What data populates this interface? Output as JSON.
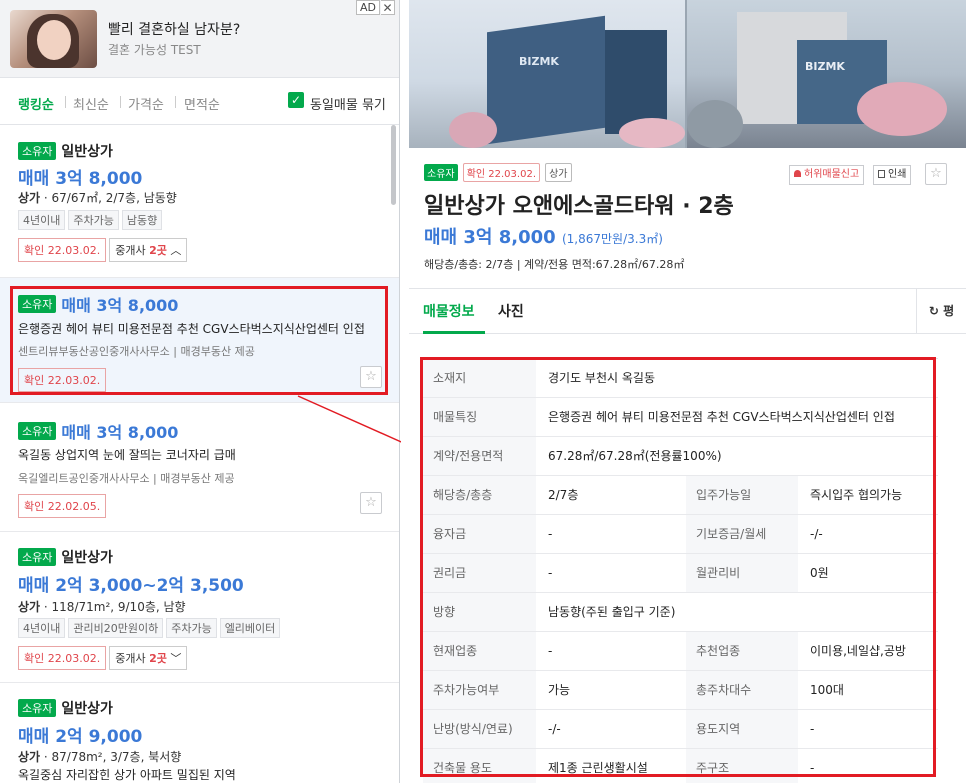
{
  "ad": {
    "title": "빨리 결혼하실 남자분?",
    "subtitle": "결혼 가능성 TEST",
    "badge": "AD",
    "close": "✕"
  },
  "sort": {
    "options": [
      "랭킹순",
      "최신순",
      "가격순",
      "면적순"
    ],
    "group_label": "동일매물 묶기",
    "check": "✓"
  },
  "listings": [
    {
      "tag": "소유자",
      "type": "일반상가",
      "price": "매매 3억 8,000",
      "spec_bold": "상가",
      "spec": " · 67/67㎡, 2/7층, 남동향",
      "chips": [
        "4년이내",
        "주차가능",
        "남동향"
      ],
      "confirm": "확인 22.03.02.",
      "broker_pre": "중개사 ",
      "broker_count": "2곳",
      "broker_icon": "︿"
    },
    {
      "tag": "소유자",
      "price": "매매 3억 8,000",
      "desc": "은행증권 헤어 뷰티 미용전문점 추천 CGV스타벅스지식산업센터 인접",
      "agent": "센트리뷰부동산공인중개사사무소",
      "provider": "매경부동산 제공",
      "confirm": "확인 22.03.02.",
      "star": "☆"
    },
    {
      "tag": "소유자",
      "price": "매매 3억 8,000",
      "desc": "옥길동 상업지역 눈에 잘띄는 코너자리 급매",
      "agent": "옥길엘리트공인중개사사무소",
      "provider": "매경부동산 제공",
      "confirm": "확인 22.02.05.",
      "star": "☆"
    },
    {
      "tag": "소유자",
      "type": "일반상가",
      "price": "매매 2억 3,000~2억 3,500",
      "spec_bold": "상가",
      "spec": " · 118/71m², 9/10층, 남향",
      "chips": [
        "4년이내",
        "관리비20만원이하",
        "주차가능",
        "엘리베이터"
      ],
      "confirm": "확인 22.03.02.",
      "broker_pre": "중개사 ",
      "broker_count": "2곳",
      "broker_icon": "﹀"
    },
    {
      "tag": "소유자",
      "type": "일반상가",
      "price": "매매 2억 9,000",
      "spec_bold": "상가",
      "spec": " · 87/78m², 3/7층, 북서향",
      "desc": "옥길중심 자리잡힌 상가 아파트 밀집된 지역"
    }
  ],
  "detail": {
    "tag_owner": "소유자",
    "tag_confirm": "확인 22.03.02.",
    "tag_type": "상가",
    "report_btn": "허위매물신고",
    "print_btn": "인쇄",
    "star": "☆",
    "title": "일반상가 오앤에스골드타워 · 2층",
    "price": "매매 3억 8,000",
    "price_per": "(1,867만원/3.3㎡)",
    "meta": "해당층/총층: 2/7층 | 계약/전용 면적:67.28㎡/67.28㎡",
    "tab_info": "매물정보",
    "tab_photo": "사진",
    "refresh": "평",
    "refresh_icon": "↻",
    "photo_text": "BIZMK",
    "table": [
      {
        "k": "소재지",
        "v": "경기도 부천시 옥길동"
      },
      {
        "k": "매물특징",
        "v": "은행증권 헤어 뷰티 미용전문점 추천 CGV스타벅스지식산업센터 인접"
      },
      {
        "k": "계약/전용면적",
        "v": "67.28㎡/67.28㎡(전용률100%)"
      },
      {
        "k": "해당층/총층",
        "v": "2/7층",
        "k2": "입주가능일",
        "v2": "즉시입주 협의가능"
      },
      {
        "k": "융자금",
        "v": "-",
        "k2": "기보증금/월세",
        "v2": "-/-"
      },
      {
        "k": "권리금",
        "v": "-",
        "k2": "월관리비",
        "v2": "0원"
      },
      {
        "k": "방향",
        "v": "남동향(주된 출입구 기준)"
      },
      {
        "k": "현재업종",
        "v": "-",
        "k2": "추천업종",
        "v2": "이미용,네일샵,공방"
      },
      {
        "k": "주차가능여부",
        "v": "가능",
        "k2": "총주차대수",
        "v2": "100대"
      },
      {
        "k": "난방(방식/연료)",
        "v": "-/-",
        "k2": "용도지역",
        "v2": "-"
      },
      {
        "k": "건축물 용도",
        "v": "제1종 근린생활시설",
        "k2": "주구조",
        "v2": "-"
      }
    ]
  }
}
